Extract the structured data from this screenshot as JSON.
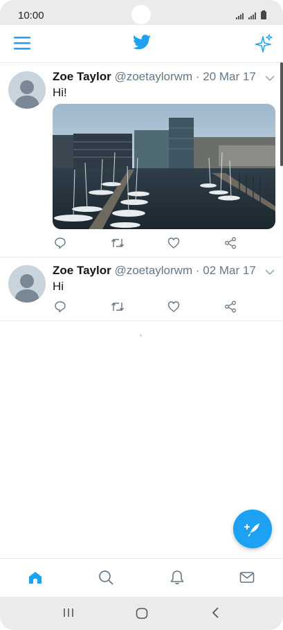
{
  "status_bar": {
    "time": "10:00"
  },
  "colors": {
    "accent": "#1da1f2",
    "text": "#14171a",
    "muted": "#657786",
    "divider": "#e6ecf0"
  },
  "top_bar": {
    "left_icon": "menu-icon",
    "center_icon": "twitter-bird-icon",
    "right_icon": "sparkle-icon"
  },
  "tweets": [
    {
      "name": "Zoe Taylor",
      "handle": "@zoetaylorwm",
      "date": "· 20 Mar 17",
      "text": "Hi!",
      "has_media": true
    },
    {
      "name": "Zoe Taylor",
      "handle": "@zoetaylorwm",
      "date": "· 02 Mar 17",
      "text": "Hi",
      "has_media": false
    }
  ],
  "tweet_actions": [
    "reply-icon",
    "retweet-icon",
    "like-icon",
    "share-icon"
  ],
  "bottom_nav": [
    "home-icon",
    "search-icon",
    "notifications-icon",
    "messages-icon"
  ],
  "system_nav": [
    "recent-apps-icon",
    "home-button-icon",
    "back-icon"
  ]
}
